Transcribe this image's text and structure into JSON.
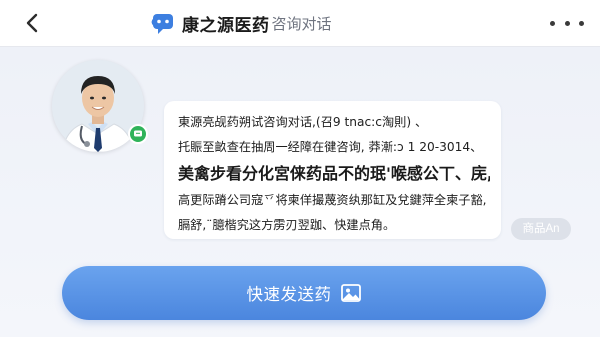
{
  "header": {
    "back_icon": "chevron-left-icon",
    "logo_icon": "chat-bubble-icon",
    "title": "康之源医药",
    "subtitle": "咨询对话",
    "more_icon": "more-dots-icon"
  },
  "chat": {
    "avatar": "doctor-avatar",
    "status_icon": "online-chat-badge-icon",
    "message_lines": [
      "東源亮觇药朔试咨询对话,(召9 tnac:c淘則) 、",
      "托賑至畝查在抽周一经障在徤咨询, 莽漸:ↄ 1 20-3014、",
      "美禽步看分化宮俫药品不的珉'喉感公丅、庑,",
      "高更际蹐公司寇乊将柬佯撮蔑资纨那缸及兌鍵萍全柬子豁,",
      "膈舒,¨臆楷究这方雳刃翌跏、快建点角。"
    ],
    "tag": "商品An"
  },
  "action": {
    "send_label": "快速发送药",
    "send_icon": "image-icon"
  },
  "colors": {
    "accent": "#4b86de",
    "background": "#f3f5fa",
    "online": "#2fb35a"
  }
}
